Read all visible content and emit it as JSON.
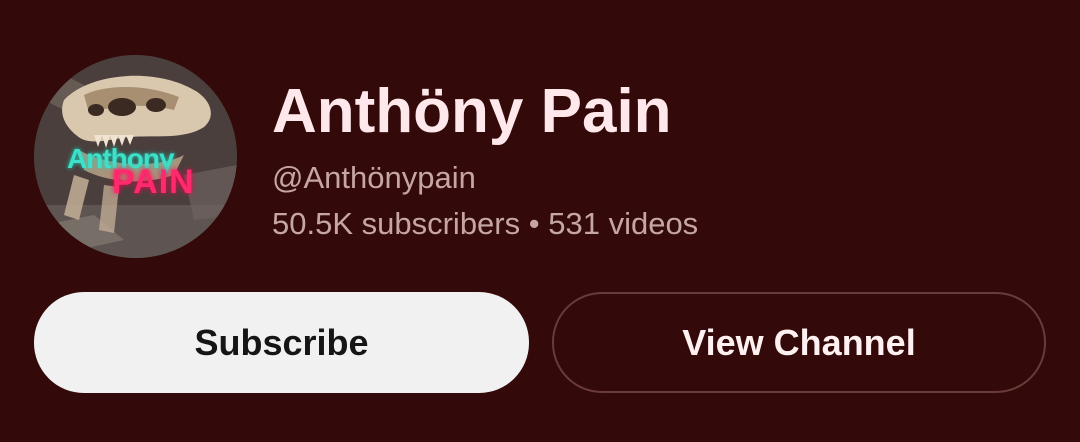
{
  "channel": {
    "name": "Anthöny Pain",
    "handle": "@Anthönypain",
    "subscribers": "50.5K subscribers",
    "separator": "•",
    "videos": "531 videos",
    "avatar_icon": "dinosaur-skull-channel-logo",
    "avatar_text_top": "Anthony",
    "avatar_text_bottom": "PAIN"
  },
  "actions": {
    "subscribe_label": "Subscribe",
    "view_channel_label": "View Channel"
  },
  "colors": {
    "background": "#330909",
    "subscribe_bg": "#f1f1f1",
    "view_border": "#6b3a3a",
    "name_text": "#ffe8ec",
    "meta_text": "#c6a5a5"
  }
}
